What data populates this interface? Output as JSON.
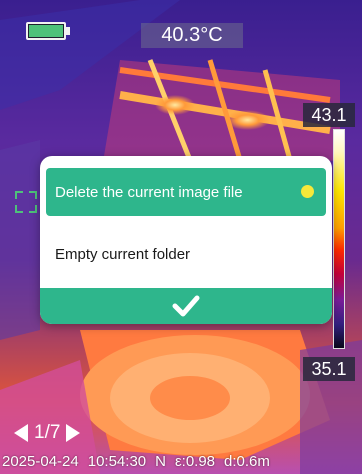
{
  "battery": {
    "level_label": "battery",
    "icon": "battery-icon"
  },
  "center_temperature": "40.3°C",
  "scale": {
    "max": "43.1",
    "min": "35.1"
  },
  "dialog": {
    "options": [
      {
        "label": "Delete the current image file",
        "selected": true
      },
      {
        "label": "Empty current folder",
        "selected": false
      }
    ],
    "confirm_icon": "checkmark-icon"
  },
  "pager": {
    "text": "1/7"
  },
  "status": {
    "date": "2025-04-24",
    "time": "10:54:30",
    "mode": "N",
    "emissivity": "ε:0.98",
    "distance": "d:0.6m"
  },
  "colors": {
    "accent": "#2eb68c",
    "selected_dot": "#f6e83a",
    "battery_fill": "#4ec27a"
  }
}
